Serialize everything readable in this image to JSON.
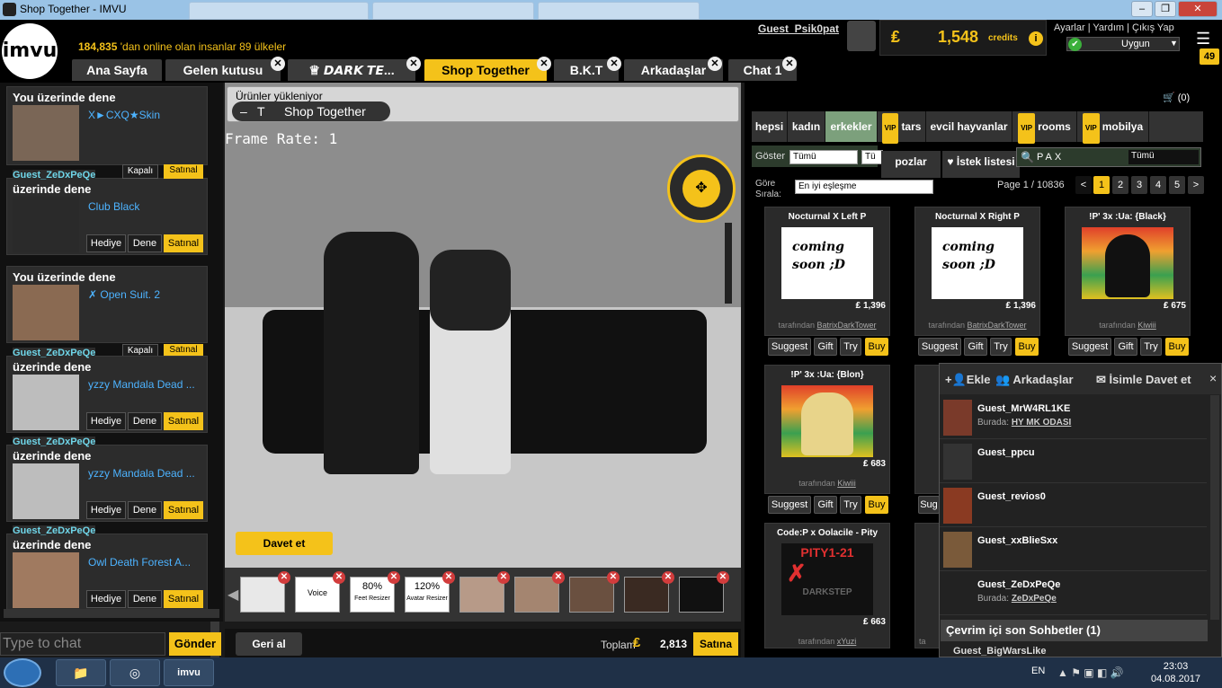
{
  "window": {
    "title": "Shop Together - IMVU"
  },
  "header": {
    "logo": "imvu",
    "online_count": "184,835",
    "online_text": "'dan online olan insanlar 89 ülkeler",
    "username": "Guest_Psik0pat",
    "currency_symbol": "₤",
    "credits": "1,548",
    "credits_word": "credits",
    "info": "i",
    "links": "Ayarlar | Yardım | Çıkış Yap",
    "status": "Uygun",
    "notif_count": "49"
  },
  "tabs": [
    {
      "label": "Ana Sayfa"
    },
    {
      "label": "Gelen kutusu"
    },
    {
      "label": "♕ 𝘿𝘼𝙍𝙆 𝙏𝙀..."
    },
    {
      "label": "Shop Together"
    },
    {
      "label": "B.K.T"
    },
    {
      "label": "Arkadaşlar"
    },
    {
      "label": "Chat 1"
    }
  ],
  "left": {
    "cards": [
      {
        "guest": "",
        "head": "You üzerinde dene",
        "item": "X►CXQ★Skin"
      },
      {
        "guest": "Guest_ZeDxPeQe",
        "head": "üzerinde dene",
        "item": "Club Black"
      },
      {
        "guest": "",
        "head": "You üzerinde dene",
        "item": "✗ Open Suit. 2"
      },
      {
        "guest": "Guest_ZeDxPeQe",
        "head": "üzerinde dene",
        "item": "yzzy Mandala Dead ..."
      },
      {
        "guest": "Guest_ZeDxPeQe",
        "head": "üzerinde dene",
        "item": "yzzy Mandala Dead ..."
      },
      {
        "guest": "Guest_ZeDxPeQe",
        "head": "üzerinde dene",
        "item": "Owl Death Forest A..."
      }
    ],
    "btn_hediye": "Hediye",
    "btn_dene": "Dene",
    "btn_satinal": "Satınal",
    "btn_kapali": "Kapalı",
    "chat_placeholder": "Type to chat",
    "send": "Gönder"
  },
  "scene": {
    "loading": "Ürünler yükleniyor",
    "shop_together": "Shop Together",
    "minus": "–",
    "frame_rate": "Frame Rate: 1",
    "davet": "Davet et",
    "gerial": "Geri al",
    "toplam": "Toplam",
    "toplam_value": "2,813",
    "satina": "Satına",
    "tray_voice": "Voice",
    "tray_80": "80%",
    "tray_80b": "Feet Resizer",
    "tray_120": "120%",
    "tray_120b": "Avatar Resizer"
  },
  "shop": {
    "cart": "(0)",
    "categories": [
      "hepsi",
      "kadın",
      "erkekler",
      "tars",
      "evcil hayvanlar",
      "rooms",
      "mobilya"
    ],
    "vip": "VIP",
    "goster": "Göster",
    "tumu": "Tümü",
    "tum2": "Tü",
    "pozlar": "pozlar",
    "istek": "İstek listesi",
    "search_value": "PAX",
    "search_scope": "Tümü",
    "gore": "Göre",
    "sirala": "Sırala:",
    "sort": "En iyi eşleşme",
    "page_info": "Page 1 / 10836",
    "pages": [
      "1",
      "2",
      "3",
      "4",
      "5",
      ">"
    ],
    "products": [
      {
        "title": "Nocturnal X Left P",
        "img_text1": "coming",
        "img_text2": "soon ;D",
        "price": "1,396",
        "by": "tarafından",
        "creator": "BatrixDarkTower"
      },
      {
        "title": "Nocturnal X Right P",
        "img_text1": "coming",
        "img_text2": "soon ;D",
        "price": "1,396",
        "by": "tarafından",
        "creator": "BatrixDarkTower"
      },
      {
        "title": "!P' 3x :Ua: {Black}",
        "price": "675",
        "by": "tarafından",
        "creator": "Kiwiii"
      },
      {
        "title": "!P' 3x :Ua: {Blon}",
        "price": "683",
        "by": "tarafından",
        "creator": "Kiwiii"
      },
      {
        "title": "Code:P x Oolacile - Pity",
        "img_text1": "PITY1-21",
        "img_text2": "DARKSTEP",
        "price": "663",
        "by": "tarafından",
        "creator": "xYuzi"
      }
    ],
    "btn_suggest": "Suggest",
    "btn_gift": "Gift",
    "btn_try": "Try",
    "btn_buy": "Buy",
    "sug_trunc": "Sug",
    "ta_trunc": "ta"
  },
  "friends": {
    "ekle": "Ekle",
    "arkadaslar": "Arkadaşlar",
    "isimle": "İsimle Davet et",
    "close": "×",
    "list": [
      {
        "name": "Guest_MrW4RL1KE",
        "burada": "Burada:",
        "where": "HY MK ODASI"
      },
      {
        "name": "Guest_ppcu",
        "burada": "",
        "where": ""
      },
      {
        "name": "Guest_revios0",
        "burada": "",
        "where": ""
      },
      {
        "name": "Guest_xxBlieSxx",
        "burada": "",
        "where": ""
      },
      {
        "name": "Guest_ZeDxPeQe",
        "burada": "Burada:",
        "where": "ZeDxPeQe"
      }
    ],
    "recent": "Çevrim içi son Sohbetler (1)",
    "recent_peek": "Guest_BigWarsLike"
  },
  "taskbar": {
    "lang": "EN",
    "time": "23:03",
    "date": "04.08.2017"
  }
}
